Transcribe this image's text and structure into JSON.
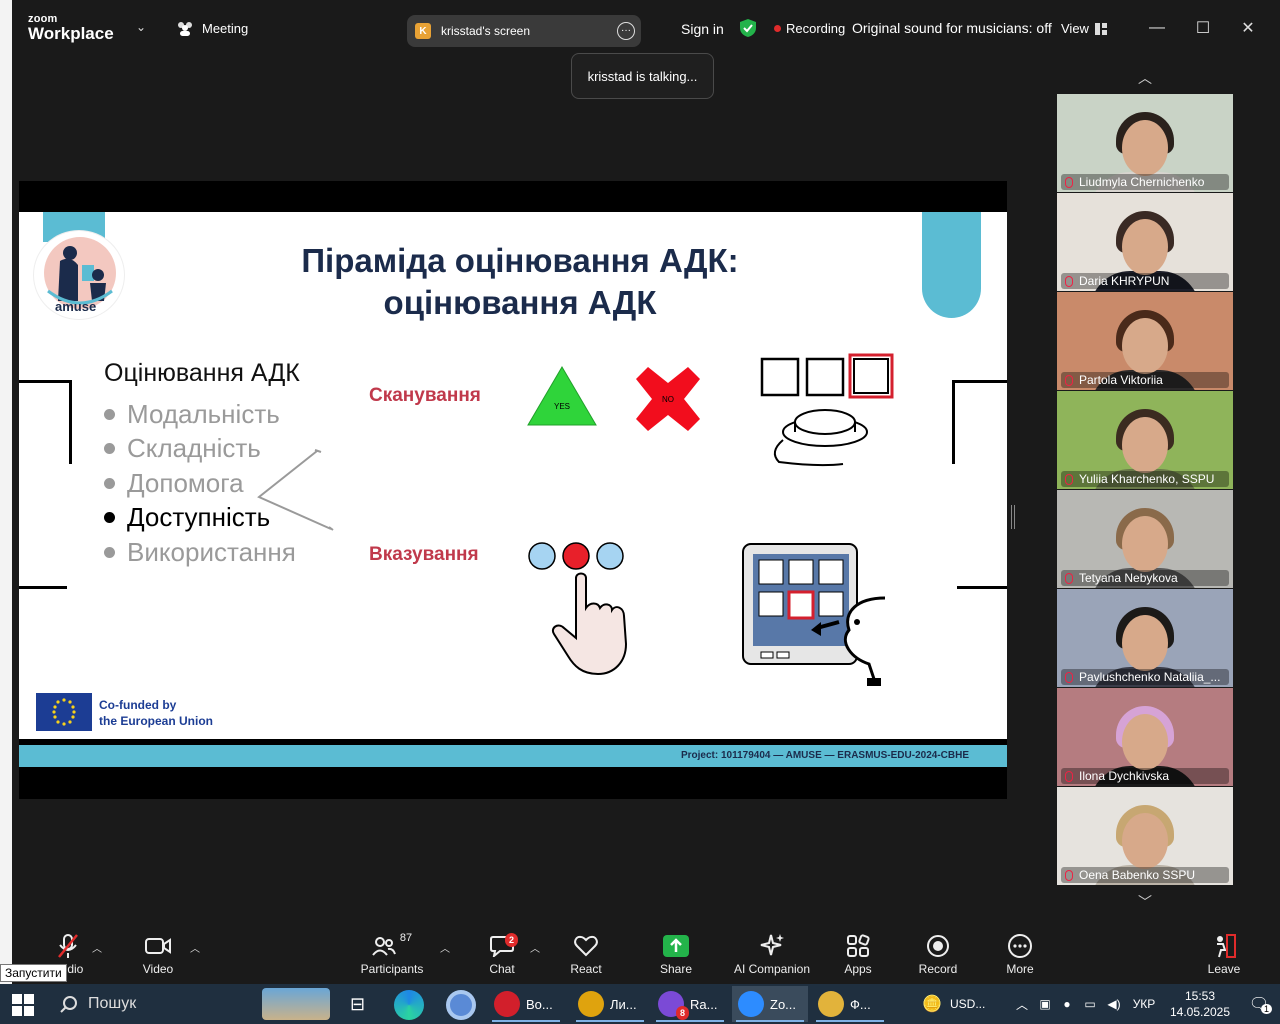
{
  "topbar": {
    "brand_small": "zoom",
    "brand_large": "Workplace",
    "meeting_label": "Meeting",
    "screen_pill_initial": "K",
    "screen_pill_label": "krisstad's screen",
    "sign_in": "Sign in",
    "recording": "Recording",
    "original_sound": "Original sound for musicians: off",
    "view": "View"
  },
  "talking_tooltip": "krisstad is talking...",
  "slide": {
    "title_line1": "Піраміда оцінювання АДК:",
    "title_line2": "оцінювання АДК",
    "logo_text": "amuse",
    "heading": "Оцінювання АДК",
    "bullets": [
      "Модальність",
      "Складність",
      "Допомога",
      "Доступність",
      "Використання"
    ],
    "scanning_label": "Сканування",
    "pointing_label": "Вказування",
    "yes_label": "YES",
    "no_label": "NO",
    "eu_line1": "Co-funded by",
    "eu_line2": "the European Union",
    "project_text": "Project: 101179404 — AMUSE — ERASMUS-EDU-2024-CBHE"
  },
  "gallery": [
    {
      "name": "Liudmyla Chernichenko",
      "bg": "#c9d3c6",
      "hair": "#2a211c",
      "body": "#d8d4cf"
    },
    {
      "name": "Daria KHRYPUN",
      "bg": "#e6e1da",
      "hair": "#3a2a24",
      "body": "#1d1f2a"
    },
    {
      "name": "Partola Viktoriia",
      "bg": "#c98a6a",
      "hair": "#4a2a1a",
      "body": "#2c2a2a"
    },
    {
      "name": "Yuliia Kharchenko, SSPU",
      "bg": "#8fb45a",
      "hair": "#3b2b20",
      "body": "#6a7a4a"
    },
    {
      "name": "Tetyana Nebykova",
      "bg": "#b8b8b4",
      "hair": "#8a6a4a",
      "body": "#5a5a5a"
    },
    {
      "name": "Pavlushchenko Nataliia_...",
      "bg": "#9aa4b8",
      "hair": "#1c1a18",
      "body": "#3a3d4a"
    },
    {
      "name": "Ilona Dychkivska",
      "bg": "#b57c80",
      "hair": "#d6a3d6",
      "body": "#1a1a1a"
    },
    {
      "name": "Oena Babenko SSPU",
      "bg": "#e6e3de",
      "hair": "#c7a772",
      "body": "#bcb4a8"
    }
  ],
  "toolbar": {
    "audio": "Audio",
    "video": "Video",
    "participants": "Participants",
    "participants_count": "87",
    "chat": "Chat",
    "chat_badge": "2",
    "react": "React",
    "share": "Share",
    "ai_companion": "AI Companion",
    "apps": "Apps",
    "record": "Record",
    "more": "More",
    "leave": "Leave"
  },
  "win_tooltip": "Запустити",
  "taskbar": {
    "search": "Пошук",
    "apps": [
      {
        "label": "Во...",
        "color": "#d21f2b"
      },
      {
        "label": "Ли...",
        "color": "#dfa30e"
      },
      {
        "label": "Ra...",
        "color": "#7b4ad6",
        "badge": "8"
      },
      {
        "label": "Zo...",
        "color": "#2d8cff"
      },
      {
        "label": "Ф...",
        "color": "#e2b33b"
      }
    ],
    "currency": "USD...",
    "lang": "УКР",
    "time": "15:53",
    "date": "14.05.2025",
    "notif": "1"
  },
  "colors": {
    "accent": "#5bbcd3",
    "title": "#1b2b4b",
    "red_label": "#c0394b",
    "zoom_blue": "#2d8cff"
  }
}
